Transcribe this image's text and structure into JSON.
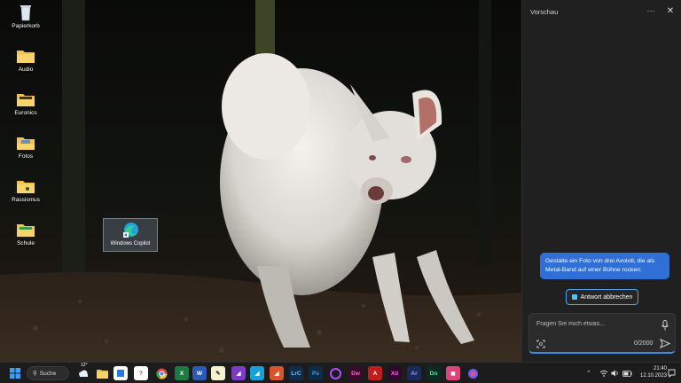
{
  "desktop": {
    "icons": [
      {
        "label": "Papierkorb",
        "icon": "recycle-bin-icon"
      },
      {
        "label": "Audio",
        "icon": "folder-icon"
      },
      {
        "label": "Euronics",
        "icon": "folder-icon"
      },
      {
        "label": "Fotos",
        "icon": "folder-icon"
      },
      {
        "label": "Rassismus",
        "icon": "folder-icon"
      },
      {
        "label": "Schule",
        "icon": "folder-icon"
      }
    ],
    "selected_icon": {
      "label": "Windows Copilot",
      "icon": "copilot-icon"
    },
    "wallpaper": "white-wallaby-photo"
  },
  "copilot": {
    "title": "Vorschau",
    "more_icon": "more-icon",
    "close_icon": "close-icon",
    "user_message": "Gestalte ein Foto von drei Axolotl, die als Metal-Band auf einer Bühne rocken.",
    "stop_button": "Antwort abbrechen",
    "input_placeholder": "Fragen Sie mich etwas...",
    "counter": "0/2000",
    "accent": "#2f6fd6"
  },
  "taskbar": {
    "search_label": "Suche",
    "weather": "12°",
    "apps": [
      "start",
      "search",
      "weather",
      "explorer",
      "store",
      "app-red",
      "chrome",
      "excel",
      "word",
      "notepad",
      "affinity-photo",
      "affinity-designer",
      "affinity-publisher",
      "lightroom-classic",
      "photoshop",
      "circle-app",
      "dreamweaver",
      "acrobat",
      "xd",
      "animate",
      "dimension",
      "snip",
      "copilot-app"
    ],
    "app_labels": {
      "lrc": "LrC",
      "ps": "Ps",
      "dw": "Dw",
      "xd": "Xd",
      "ar": "Ar",
      "dn": "Dn"
    },
    "time": "21:40",
    "date": "12.10.2023"
  }
}
